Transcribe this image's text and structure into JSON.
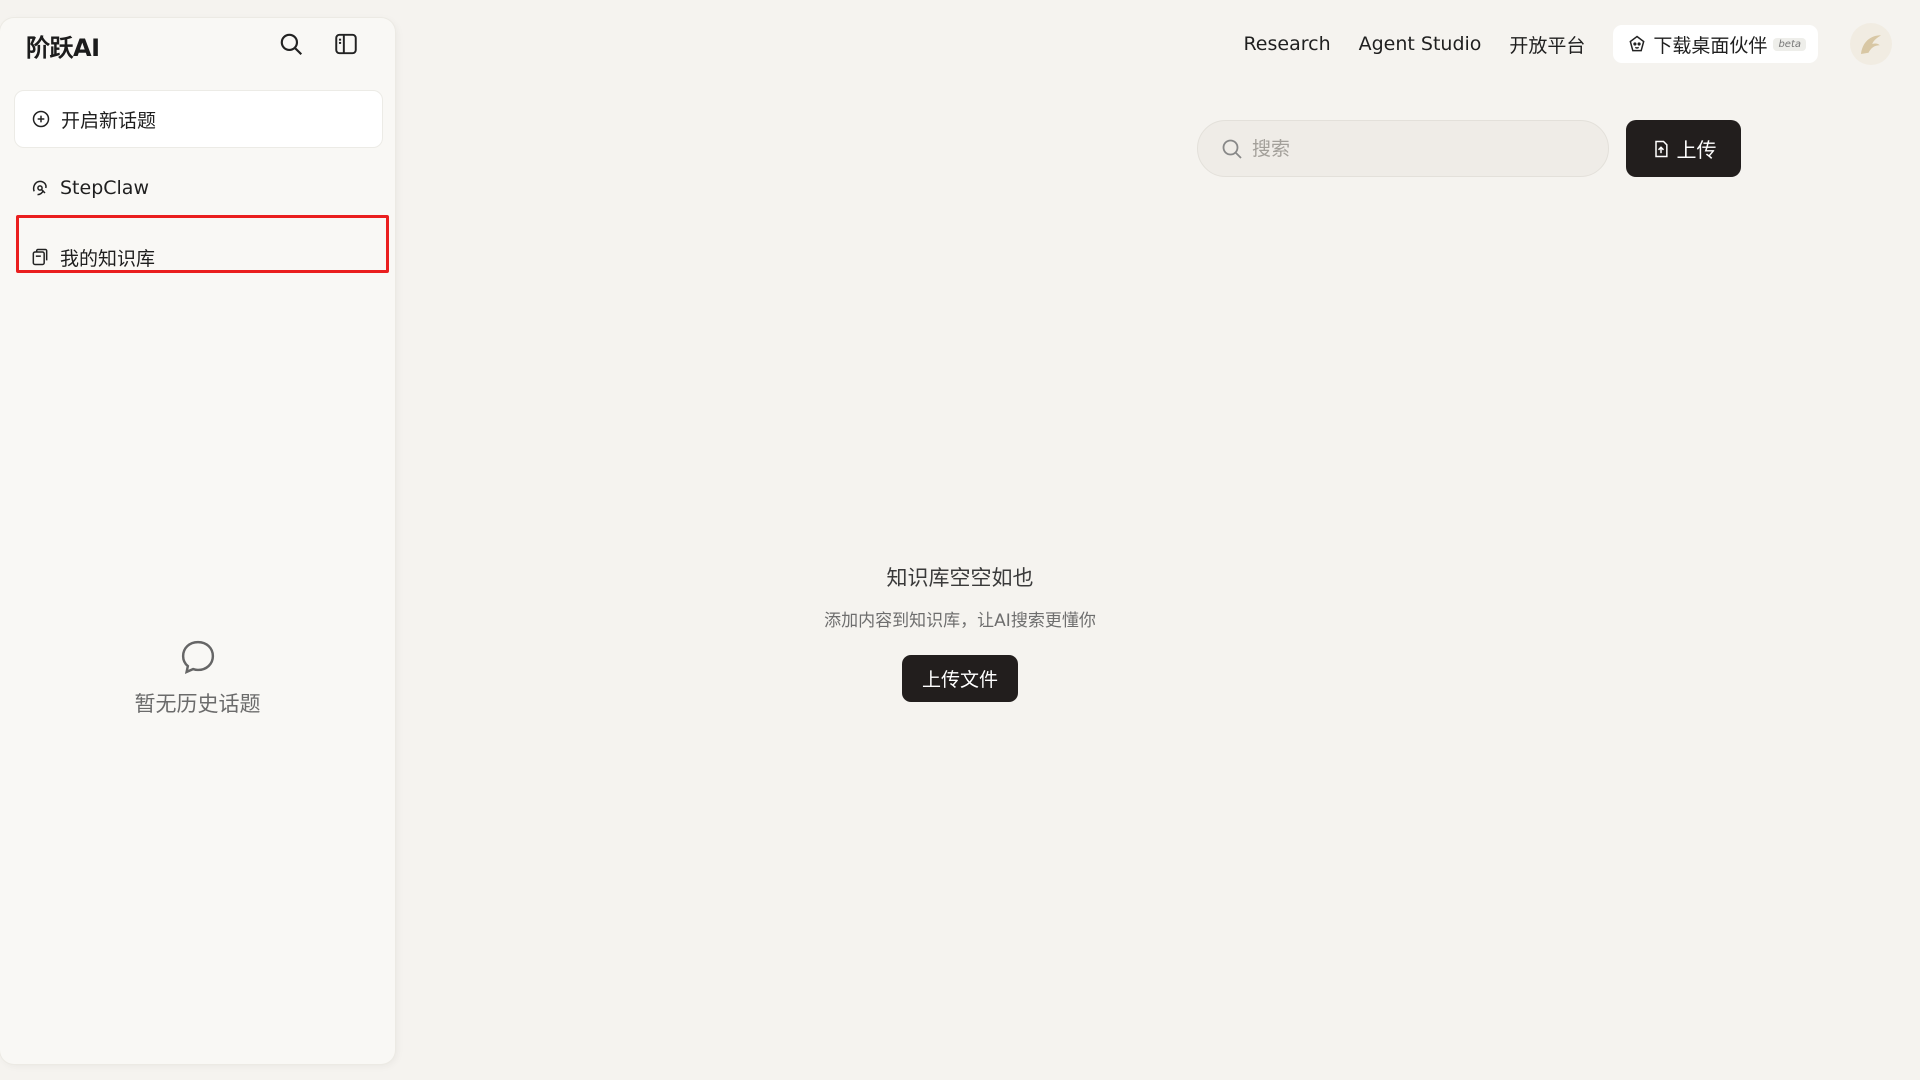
{
  "brand": {
    "name": "阶跃AI"
  },
  "sidebar": {
    "items": [
      {
        "label": "开启新话题",
        "icon": "plus-circle-icon"
      },
      {
        "label": "StepClaw",
        "icon": "claw-icon"
      },
      {
        "label": "我的知识库",
        "icon": "knowledge-base-icon"
      }
    ],
    "empty_history_text": "暂无历史话题"
  },
  "topnav": {
    "links": [
      "Research",
      "Agent Studio",
      "开放平台"
    ],
    "download_label": "下载桌面伙伴",
    "beta_label": "beta"
  },
  "search": {
    "placeholder": "搜索"
  },
  "upload": {
    "label": "上传"
  },
  "empty_state": {
    "title": "知识库空空如也",
    "subtitle": "添加内容到知识库，让AI搜索更懂你",
    "button_label": "上传文件"
  },
  "colors": {
    "background": "#f5f3ef",
    "sidebar": "#f9f8f5",
    "dark_button": "#221e1d",
    "highlight": "#ea1f1f"
  }
}
